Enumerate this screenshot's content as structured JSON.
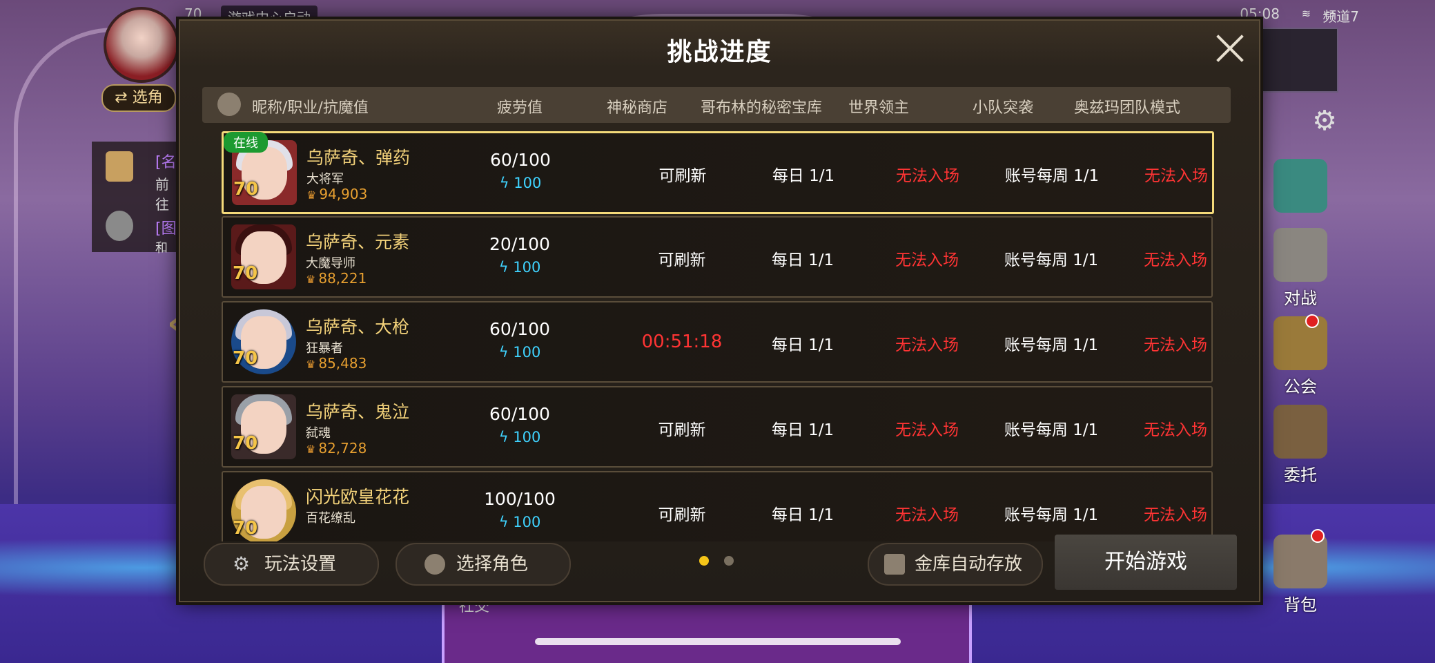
{
  "status_bar": {
    "level": "70",
    "hint": "游戏中心启动",
    "time": "05:08",
    "channel": "频道7"
  },
  "left_hud": {
    "switch_label": "⇄ 选角",
    "item1_tag": "[名",
    "item1_text": "前往",
    "item2_tag": "[图",
    "item2_text": "和"
  },
  "right_hud": {
    "buttons": [
      "对战",
      "公会",
      "委托",
      "背包"
    ]
  },
  "bottom_hud": {
    "social": "社交"
  },
  "modal": {
    "title": "挑战进度",
    "columns": [
      "昵称/职业/抗魔值",
      "疲劳值",
      "神秘商店",
      "哥布林的秘密宝库",
      "世界领主",
      "小队突袭",
      "奥兹玛团队模式"
    ],
    "online_label": "在线",
    "characters": [
      {
        "name": "乌萨奇、弹药",
        "job": "大将军",
        "power": "94,903",
        "level": "70",
        "fatigue": "60/100",
        "stamina": "100",
        "shop": "可刷新",
        "goblin": "每日 1/1",
        "world_boss": "无法入场",
        "raid": "账号每周 1/1",
        "ozma": "无法入场",
        "online": true
      },
      {
        "name": "乌萨奇、元素",
        "job": "大魔导师",
        "power": "88,221",
        "level": "70",
        "fatigue": "20/100",
        "stamina": "100",
        "shop": "可刷新",
        "goblin": "每日 1/1",
        "world_boss": "无法入场",
        "raid": "账号每周 1/1",
        "ozma": "无法入场",
        "online": false
      },
      {
        "name": "乌萨奇、大枪",
        "job": "狂暴者",
        "power": "85,483",
        "level": "70",
        "fatigue": "60/100",
        "stamina": "100",
        "shop": "00:51:18",
        "goblin": "每日 1/1",
        "world_boss": "无法入场",
        "raid": "账号每周 1/1",
        "ozma": "无法入场",
        "online": false
      },
      {
        "name": "乌萨奇、鬼泣",
        "job": "弑魂",
        "power": "82,728",
        "level": "70",
        "fatigue": "60/100",
        "stamina": "100",
        "shop": "可刷新",
        "goblin": "每日 1/1",
        "world_boss": "无法入场",
        "raid": "账号每周 1/1",
        "ozma": "无法入场",
        "online": false
      },
      {
        "name": "闪光欧皇花花",
        "job": "百花缭乱",
        "power": "",
        "level": "70",
        "fatigue": "100/100",
        "stamina": "100",
        "shop": "可刷新",
        "goblin": "每日 1/1",
        "world_boss": "无法入场",
        "raid": "账号每周 1/1",
        "ozma": "无法入场",
        "online": false
      }
    ],
    "buttons": {
      "settings": "玩法设置",
      "select_char": "选择角色",
      "auto_store": "金库自动存放",
      "start": "开始游戏"
    },
    "pages": 2,
    "current_page": 1
  },
  "colors": {
    "gold": "#f3d27a",
    "red": "#ff3434",
    "cyan": "#3fd3ff",
    "online_green": "#1c9a30"
  }
}
